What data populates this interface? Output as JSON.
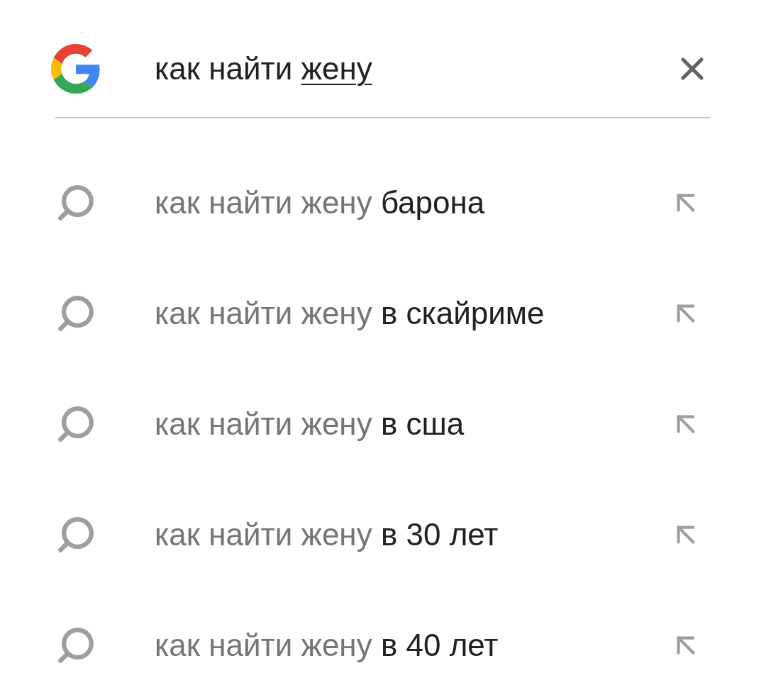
{
  "search": {
    "text": "как найти",
    "composing": "жену"
  },
  "suggestions": [
    {
      "query": "как найти жену",
      "completion": "барона"
    },
    {
      "query": "как найти жену",
      "completion": "в скайриме"
    },
    {
      "query": "как найти жену",
      "completion": "в сша"
    },
    {
      "query": "как найти жену",
      "completion": "в 30 лет"
    },
    {
      "query": "как найти жену",
      "completion": "в 40 лет"
    }
  ]
}
